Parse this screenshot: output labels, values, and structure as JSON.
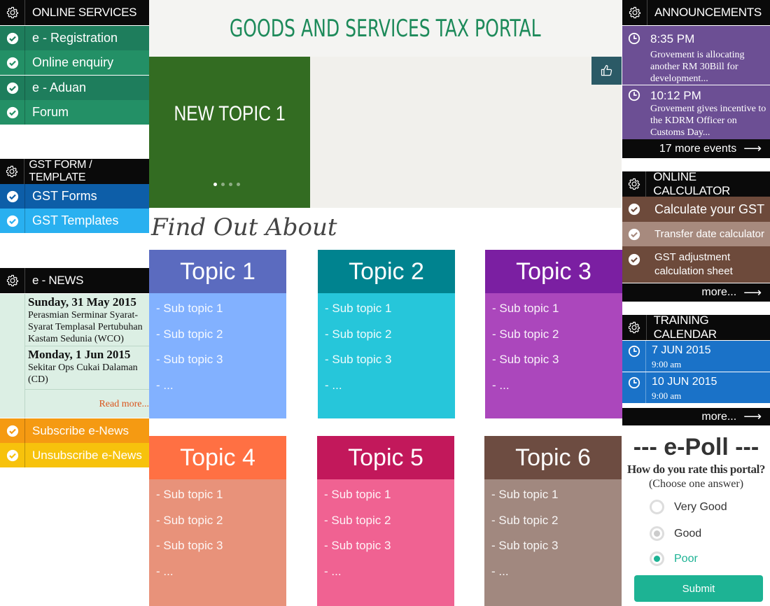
{
  "online_services": {
    "title": "ONLINE SERVICES",
    "items": [
      {
        "label": "e - Registration"
      },
      {
        "label": "Online enquiry"
      },
      {
        "label": "e - Aduan"
      },
      {
        "label": "Forum"
      }
    ]
  },
  "gst_form": {
    "title": "GST FORM / TEMPLATE",
    "items": [
      {
        "label": "GST Forms"
      },
      {
        "label": "GST Templates"
      }
    ]
  },
  "enews": {
    "title": "e - NEWS",
    "entries": [
      {
        "date": "Sunday, 31 May 2015",
        "text": "Perasmian Serminar Syarat-Syarat Templasal Pertubuhan Kastam Sedunia (WCO)"
      },
      {
        "date": "Monday, 1 Jun 2015",
        "text": "Sekitar Ops Cukai Dalaman (CD)"
      }
    ],
    "read_more": "Read more...",
    "subscribe": "Subscribe e-News",
    "unsubscribe": "Unsubscribe e-News"
  },
  "header": {
    "title": "GOODS AND SERVICES TAX PORTAL"
  },
  "slider": {
    "topic": "NEW TOPIC 1",
    "slide_count": 4,
    "active_slide": 1
  },
  "find_out": {
    "heading": "Find Out About"
  },
  "topics": [
    {
      "title": "Topic 1",
      "subs": [
        "- Sub topic 1",
        "- Sub topic 2",
        "- Sub topic 3",
        "- ..."
      ],
      "head_color": "#5b6bbf",
      "body_color": "#82b1ff"
    },
    {
      "title": "Topic 2",
      "subs": [
        "- Sub topic 1",
        "- Sub topic 2",
        "- Sub topic 3",
        "- ..."
      ],
      "head_color": "#00838f",
      "body_color": "#26c6da"
    },
    {
      "title": "Topic 3",
      "subs": [
        "- Sub topic 1",
        "- Sub topic 2",
        "- Sub topic 3",
        "- ..."
      ],
      "head_color": "#7b1fa2",
      "body_color": "#ab47bc"
    },
    {
      "title": "Topic 4",
      "subs": [
        "- Sub topic 1",
        "- Sub topic 2",
        "- Sub topic 3",
        "- ..."
      ],
      "head_color": "#ff7043",
      "body_color": "#e8927a"
    },
    {
      "title": "Topic 5",
      "subs": [
        "- Sub topic 1",
        "- Sub topic 2",
        "- Sub topic 3",
        "- ..."
      ],
      "head_color": "#c2185b",
      "body_color": "#f06292"
    },
    {
      "title": "Topic 6",
      "subs": [
        "- Sub topic 1",
        "- Sub topic 2",
        "- Sub topic 3",
        "- ..."
      ],
      "head_color": "#6d4c41",
      "body_color": "#a1887f"
    }
  ],
  "announcements": {
    "title": "ANNOUNCEMENTS",
    "items": [
      {
        "time": "8:35 PM",
        "text": "Grovement is allocating another RM 30Bill for development..."
      },
      {
        "time": "10:12 PM",
        "text": "Grovement gives incentive to the KDRM Officer on Customs Day..."
      }
    ],
    "more": "17 more events"
  },
  "calculator": {
    "title": "ONLINE CALCULATOR",
    "items": [
      {
        "label": "Calculate your GST"
      },
      {
        "label": "Transfer date calculator"
      },
      {
        "label": "GST adjustment calculation sheet"
      }
    ],
    "more": "more..."
  },
  "training": {
    "title": "TRAINING CALENDAR",
    "items": [
      {
        "date": "7 JUN 2015",
        "time": "9:00 am"
      },
      {
        "date": "10 JUN 2015",
        "time": "9:00 am"
      }
    ],
    "more": "more..."
  },
  "poll": {
    "title": "--- e-Poll ---",
    "question": "How do you rate this portal?",
    "hint": "(Choose one answer)",
    "options": [
      "Very Good",
      "Good",
      "Poor"
    ],
    "selected": "Poor",
    "submit": "Submit"
  },
  "colors": {
    "accent_green": "#1d8a5a",
    "services_green": "#1e7d5c",
    "forms_blue": "#0d5ea8",
    "templates_blue": "#29b0f0",
    "subscribe_orange": "#f59a12",
    "unsubscribe_yellow": "#f7c20c",
    "announce_purple": "#6c4f94",
    "calc_brown": "#6d4a3b",
    "training_blue": "#1a72c8",
    "submit_teal": "#1db394"
  },
  "icons": [
    "gear-icon",
    "check-circle-icon",
    "clock-icon",
    "thumbs-up-icon",
    "arrow-right-icon"
  ]
}
